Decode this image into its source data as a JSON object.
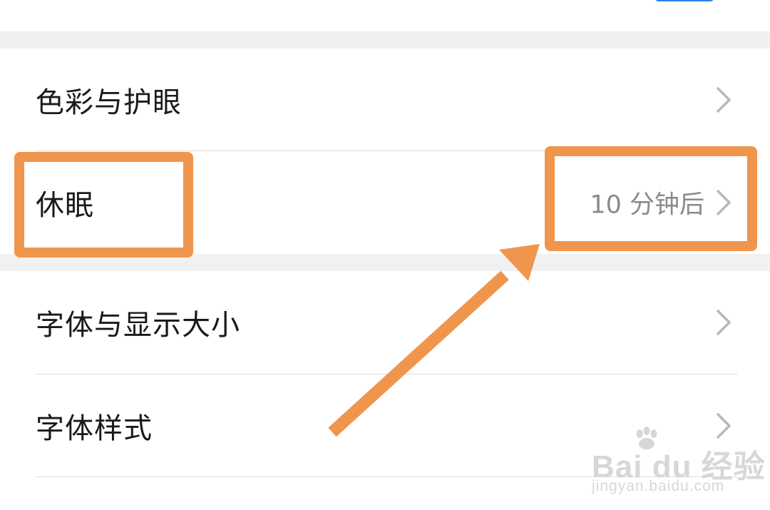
{
  "settings": {
    "items": [
      {
        "label": "色彩与护眼",
        "value": ""
      },
      {
        "label": "休眠",
        "value": "10 分钟后"
      },
      {
        "label": "字体与显示大小",
        "value": ""
      },
      {
        "label": "字体样式",
        "value": ""
      }
    ]
  },
  "annotation": {
    "color": "#f0954c",
    "highlighted_items": [
      "休眠",
      "10 分钟后"
    ],
    "arrow_direction": "up-right"
  },
  "watermark": {
    "logo_text": "Bai du 经验",
    "url": "jingyan.baidu.com"
  },
  "colors": {
    "accent_top": "#2a7ee5",
    "section_gap": "#f1f1f1",
    "value_text": "#8a8a8a"
  },
  "icons": {
    "row_chevron": "chevron-right-icon"
  }
}
